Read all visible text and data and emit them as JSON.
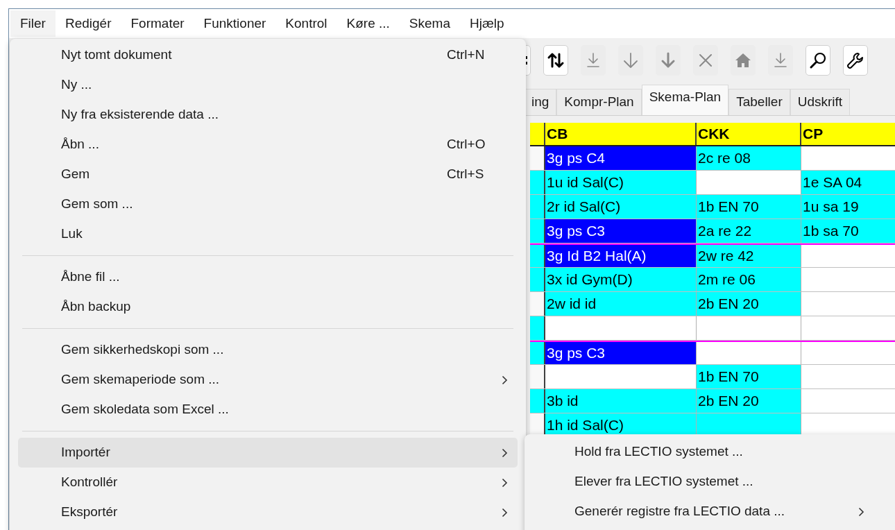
{
  "menubar": [
    {
      "label": "Filer",
      "selected": true
    },
    {
      "label": "Redigér",
      "selected": false
    },
    {
      "label": "Formater",
      "selected": false
    },
    {
      "label": "Funktioner",
      "selected": false
    },
    {
      "label": "Kontrol",
      "selected": false
    },
    {
      "label": "Køre ...",
      "selected": false
    },
    {
      "label": "Skema",
      "selected": false
    },
    {
      "label": "Hjælp",
      "selected": false
    }
  ],
  "toolbar": [
    {
      "kind": "grip",
      "disabled": false
    },
    {
      "kind": "sort",
      "disabled": false
    },
    {
      "kind": "down_bar",
      "disabled": true
    },
    {
      "kind": "down",
      "disabled": true
    },
    {
      "kind": "down_bold",
      "disabled": true
    },
    {
      "kind": "clear",
      "disabled": true
    },
    {
      "kind": "home",
      "disabled": true
    },
    {
      "kind": "down_bar",
      "disabled": true
    },
    {
      "kind": "search",
      "disabled": false
    },
    {
      "kind": "wrench",
      "disabled": false
    }
  ],
  "tabs": [
    {
      "label": "ing",
      "selected": false
    },
    {
      "label": "Kompr-Plan",
      "selected": false
    },
    {
      "label": "Skema-Plan",
      "selected": true
    },
    {
      "label": "Tabeller",
      "selected": false
    },
    {
      "label": "Udskrift",
      "selected": false
    }
  ],
  "grid": {
    "columns": [
      "CB",
      "CKK",
      "CP"
    ],
    "rows": [
      {
        "marked": false,
        "group_start": false,
        "cells": [
          {
            "text": "3g ps C4",
            "color": "#0000ff"
          },
          {
            "text": "2c re 08",
            "color": "#00ffff"
          },
          null
        ]
      },
      {
        "marked": true,
        "group_start": false,
        "cells": [
          {
            "text": "1u id Sal(C)",
            "color": "#00ffff"
          },
          null,
          {
            "text": "1e SA 04",
            "color": "#00ffff"
          }
        ]
      },
      {
        "marked": true,
        "group_start": false,
        "cells": [
          {
            "text": "2r id Sal(C)",
            "color": "#00ffff"
          },
          {
            "text": "1b EN 70",
            "color": "#00ffff"
          },
          {
            "text": "1u sa 19",
            "color": "#00ffff"
          }
        ]
      },
      {
        "marked": true,
        "group_start": false,
        "cells": [
          {
            "text": "3g ps C3",
            "color": "#0000ff"
          },
          {
            "text": "2a re 22",
            "color": "#00ffff"
          },
          {
            "text": "1b sa 70",
            "color": "#00ffff"
          }
        ]
      },
      {
        "marked": true,
        "group_start": true,
        "cells": [
          {
            "text": "3g Id B2 Hal(A)",
            "color": "#0000ff"
          },
          {
            "text": "2w re 42",
            "color": "#00ffff"
          },
          null
        ]
      },
      {
        "marked": true,
        "group_start": false,
        "cells": [
          {
            "text": "3x id Gym(D)",
            "color": "#00ffff"
          },
          {
            "text": "2m re 06",
            "color": "#00ffff"
          },
          null
        ]
      },
      {
        "marked": false,
        "group_start": false,
        "cells": [
          {
            "text": "2w id id",
            "color": "#00ffff"
          },
          {
            "text": "2b EN 20",
            "color": "#00ffff"
          },
          null
        ]
      },
      {
        "marked": true,
        "group_start": false,
        "cells": [
          null,
          null,
          null
        ]
      },
      {
        "marked": true,
        "group_start": true,
        "cells": [
          {
            "text": "3g ps C3",
            "color": "#0000ff"
          },
          null,
          null
        ]
      },
      {
        "marked": false,
        "group_start": false,
        "cells": [
          null,
          {
            "text": "1b EN 70",
            "color": "#00ffff"
          },
          null
        ]
      },
      {
        "marked": true,
        "group_start": false,
        "cells": [
          {
            "text": "3b id",
            "color": "#00ffff"
          },
          {
            "text": "2b EN 20",
            "color": "#00ffff"
          },
          null
        ]
      },
      {
        "marked": false,
        "group_start": false,
        "cells": [
          {
            "text": "1h id Sal(C)",
            "color": "#00ffff"
          },
          {
            "color": "#00ffff"
          },
          null
        ]
      }
    ]
  },
  "file_menu": {
    "sections": [
      [
        {
          "label": "Nyt tomt dokument",
          "shortcut": "Ctrl+N",
          "submenu": false,
          "selected": false
        },
        {
          "label": "Ny ...",
          "submenu": false,
          "selected": false
        },
        {
          "label": "Ny fra eksisterende data ...",
          "submenu": false,
          "selected": false
        },
        {
          "label": "Åbn ...",
          "shortcut": "Ctrl+O",
          "submenu": false,
          "selected": false
        },
        {
          "label": "Gem",
          "shortcut": "Ctrl+S",
          "submenu": false,
          "selected": false
        },
        {
          "label": "Gem som ...",
          "submenu": false,
          "selected": false
        },
        {
          "label": "Luk",
          "submenu": false,
          "selected": false
        }
      ],
      [
        {
          "label": "Åbne fil ...",
          "submenu": false,
          "selected": false
        },
        {
          "label": "Åbn backup",
          "submenu": false,
          "selected": false
        }
      ],
      [
        {
          "label": "Gem sikkerhedskopi som ...",
          "submenu": false,
          "selected": false
        },
        {
          "label": "Gem skemaperiode som ...",
          "submenu": true,
          "selected": false
        },
        {
          "label": "Gem skoledata som Excel ...",
          "submenu": false,
          "selected": false
        }
      ],
      [
        {
          "label": "Importér",
          "submenu": true,
          "selected": true
        },
        {
          "label": "Kontrollér",
          "submenu": true,
          "selected": false
        },
        {
          "label": "Eksportér",
          "submenu": true,
          "selected": false
        }
      ]
    ]
  },
  "import_submenu": [
    {
      "label": "Hold fra LECTIO systemet ...",
      "submenu": false
    },
    {
      "label": "Elever fra LECTIO systemet ...",
      "submenu": false
    },
    {
      "label": "Generér registre fra LECTIO data ...",
      "submenu": true
    }
  ]
}
